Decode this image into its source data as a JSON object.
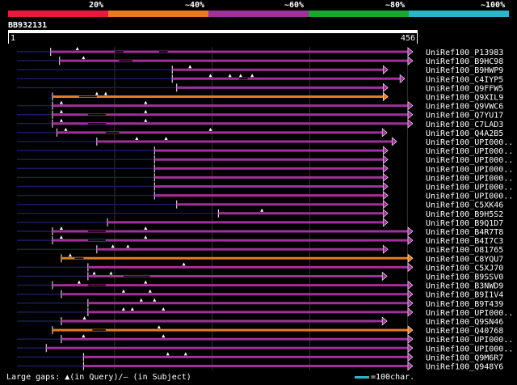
{
  "identity_legend": {
    "labels": [
      "20%",
      "~40%",
      "~60%",
      "~80%",
      "~100%"
    ],
    "colors": [
      "#e8193a",
      "#ea7a1f",
      "#a0309a",
      "#18a82e",
      "#2bb7c9"
    ]
  },
  "query": {
    "name": "BB932131",
    "start": "1",
    "end": "456",
    "length": 456
  },
  "gridlines": [
    120,
    230,
    340,
    450
  ],
  "hits": [
    {
      "label": "UniRef100_P13983",
      "color": "#a0309a",
      "start": 48,
      "end": 456,
      "dim": [
        [
          10,
          48
        ]
      ],
      "gaps": [
        [
          120,
          130
        ],
        [
          170,
          180
        ]
      ],
      "marks": [
        78
      ]
    },
    {
      "label": "UniRef100_B9HC98",
      "color": "#a0309a",
      "start": 58,
      "end": 456,
      "dim": [
        [
          10,
          58
        ]
      ],
      "gaps": [
        [
          125,
          140
        ]
      ],
      "marks": [
        85
      ]
    },
    {
      "label": "UniRef100_B9HWP9",
      "color": "#a0309a",
      "start": 185,
      "end": 428,
      "dim": [
        [
          10,
          185
        ]
      ],
      "gaps": [],
      "marks": [
        205
      ]
    },
    {
      "label": "UniRef100_C4IYP5",
      "color": "#a0309a",
      "start": 185,
      "end": 447,
      "dim": [
        [
          10,
          185
        ]
      ],
      "gaps": [
        [
          260,
          270
        ]
      ],
      "marks": [
        228,
        250,
        262,
        275
      ]
    },
    {
      "label": "UniRef100_Q9FFW5",
      "color": "#a0309a",
      "start": 190,
      "end": 428,
      "dim": [
        [
          10,
          190
        ]
      ],
      "gaps": [],
      "marks": []
    },
    {
      "label": "UniRef100_Q9XIL9",
      "color": "#ea7a1f",
      "start": 50,
      "end": 428,
      "dim": [],
      "gaps": [
        [
          80,
          100
        ]
      ],
      "marks": [
        100,
        110
      ]
    },
    {
      "label": "UniRef100_Q9VWC6",
      "color": "#a0309a",
      "start": 50,
      "end": 456,
      "dim": [
        [
          10,
          50
        ]
      ],
      "gaps": [],
      "marks": [
        60,
        155
      ]
    },
    {
      "label": "UniRef100_Q7YU17",
      "color": "#a0309a",
      "start": 50,
      "end": 456,
      "dim": [
        [
          10,
          50
        ]
      ],
      "gaps": [
        [
          90,
          110
        ]
      ],
      "marks": [
        60,
        155
      ]
    },
    {
      "label": "UniRef100_C7LAD3",
      "color": "#a0309a",
      "start": 50,
      "end": 456,
      "dim": [
        [
          10,
          50
        ]
      ],
      "gaps": [
        [
          90,
          110
        ]
      ],
      "marks": [
        60,
        155
      ]
    },
    {
      "label": "UniRef100_Q4A2B5",
      "color": "#a0309a",
      "start": 55,
      "end": 427,
      "dim": [
        [
          10,
          55
        ]
      ],
      "gaps": [
        [
          110,
          125
        ]
      ],
      "marks": [
        65,
        228
      ]
    },
    {
      "label": "UniRef100_UPI000..",
      "color": "#a0309a",
      "start": 100,
      "end": 438,
      "dim": [
        [
          10,
          100
        ]
      ],
      "gaps": [],
      "marks": [
        145,
        178
      ]
    },
    {
      "label": "UniRef100_UPI000..",
      "color": "#a0309a",
      "start": 165,
      "end": 428,
      "dim": [
        [
          10,
          165
        ]
      ],
      "gaps": [],
      "marks": []
    },
    {
      "label": "UniRef100_UPI000..",
      "color": "#a0309a",
      "start": 165,
      "end": 428,
      "dim": [
        [
          10,
          165
        ]
      ],
      "gaps": [],
      "marks": []
    },
    {
      "label": "UniRef100_UPI000..",
      "color": "#a0309a",
      "start": 165,
      "end": 428,
      "dim": [
        [
          10,
          165
        ]
      ],
      "gaps": [],
      "marks": []
    },
    {
      "label": "UniRef100_UPI000..",
      "color": "#a0309a",
      "start": 165,
      "end": 428,
      "dim": [
        [
          10,
          165
        ]
      ],
      "gaps": [],
      "marks": []
    },
    {
      "label": "UniRef100_UPI000..",
      "color": "#a0309a",
      "start": 165,
      "end": 428,
      "dim": [
        [
          10,
          165
        ]
      ],
      "gaps": [],
      "marks": []
    },
    {
      "label": "UniRef100_UPI000..",
      "color": "#a0309a",
      "start": 165,
      "end": 428,
      "dim": [
        [
          10,
          165
        ]
      ],
      "gaps": [],
      "marks": []
    },
    {
      "label": "UniRef100_C5XK46",
      "color": "#a0309a",
      "start": 190,
      "end": 428,
      "dim": [
        [
          10,
          190
        ]
      ],
      "gaps": [],
      "marks": []
    },
    {
      "label": "UniRef100_B9H5S2",
      "color": "#a0309a",
      "start": 237,
      "end": 428,
      "dim": [
        [
          10,
          237
        ]
      ],
      "gaps": [],
      "marks": [
        286
      ]
    },
    {
      "label": "UniRef100_B9Q1D7",
      "color": "#a0309a",
      "start": 112,
      "end": 428,
      "dim": [
        [
          10,
          112
        ]
      ],
      "gaps": [],
      "marks": []
    },
    {
      "label": "UniRef100_B4R7T8",
      "color": "#a0309a",
      "start": 50,
      "end": 456,
      "dim": [
        [
          10,
          50
        ]
      ],
      "gaps": [
        [
          90,
          110
        ]
      ],
      "marks": [
        60,
        155
      ]
    },
    {
      "label": "UniRef100_B4I7C3",
      "color": "#a0309a",
      "start": 50,
      "end": 456,
      "dim": [
        [
          10,
          50
        ]
      ],
      "gaps": [
        [
          90,
          110
        ]
      ],
      "marks": [
        60,
        155
      ]
    },
    {
      "label": "UniRef100_O81765",
      "color": "#a0309a",
      "start": 100,
      "end": 428,
      "dim": [
        [
          10,
          100
        ]
      ],
      "gaps": [],
      "marks": [
        118,
        135
      ]
    },
    {
      "label": "UniRef100_C8YQU7",
      "color": "#ea7a1f",
      "start": 60,
      "end": 456,
      "dim": [],
      "gaps": [
        [
          75,
          85
        ]
      ],
      "marks": [
        70
      ]
    },
    {
      "label": "UniRef100_C5XJ70",
      "color": "#a0309a",
      "start": 90,
      "end": 456,
      "dim": [
        [
          10,
          90
        ]
      ],
      "gaps": [],
      "marks": [
        198
      ]
    },
    {
      "label": "UniRef100_B9SSV0",
      "color": "#a0309a",
      "start": 90,
      "end": 427,
      "dim": [
        [
          10,
          90
        ]
      ],
      "gaps": [
        [
          130,
          160
        ]
      ],
      "marks": [
        97,
        116
      ]
    },
    {
      "label": "UniRef100_B3NWD9",
      "color": "#a0309a",
      "start": 50,
      "end": 456,
      "dim": [
        [
          10,
          50
        ]
      ],
      "gaps": [
        [
          90,
          110
        ]
      ],
      "marks": [
        80,
        155
      ]
    },
    {
      "label": "UniRef100_B9I1V4",
      "color": "#a0309a",
      "start": 60,
      "end": 456,
      "dim": [
        [
          10,
          60
        ]
      ],
      "gaps": [],
      "marks": [
        130,
        160
      ]
    },
    {
      "label": "UniRef100_B9T439",
      "color": "#a0309a",
      "start": 90,
      "end": 456,
      "dim": [
        [
          10,
          90
        ]
      ],
      "gaps": [],
      "marks": [
        150,
        165
      ]
    },
    {
      "label": "UniRef100_UPI000..",
      "color": "#a0309a",
      "start": 90,
      "end": 456,
      "dim": [
        [
          10,
          90
        ]
      ],
      "gaps": [],
      "marks": [
        130,
        140,
        175
      ]
    },
    {
      "label": "UniRef100_Q9SN46",
      "color": "#a0309a",
      "start": 60,
      "end": 427,
      "dim": [
        [
          10,
          60
        ]
      ],
      "gaps": [],
      "marks": [
        86
      ]
    },
    {
      "label": "UniRef100_Q40768",
      "color": "#ea7a1f",
      "start": 50,
      "end": 456,
      "dim": [],
      "gaps": [
        [
          95,
          110
        ]
      ],
      "marks": [
        170
      ]
    },
    {
      "label": "UniRef100_UPI000..",
      "color": "#a0309a",
      "start": 60,
      "end": 456,
      "dim": [
        [
          10,
          60
        ]
      ],
      "gaps": [],
      "marks": [
        85,
        175
      ]
    },
    {
      "label": "UniRef100_UPI000..",
      "color": "#a0309a",
      "start": 43,
      "end": 456,
      "dim": [
        [
          10,
          43
        ]
      ],
      "gaps": [],
      "marks": []
    },
    {
      "label": "UniRef100_Q9M6R7",
      "color": "#a0309a",
      "start": 85,
      "end": 456,
      "dim": [
        [
          10,
          85
        ]
      ],
      "gaps": [],
      "marks": [
        180,
        200
      ]
    },
    {
      "label": "UniRef100_Q948Y6",
      "color": "#a0309a",
      "start": 85,
      "end": 456,
      "dim": [
        [
          10,
          85
        ]
      ],
      "gaps": [],
      "marks": []
    }
  ],
  "footer": {
    "gaps_text": "Large gaps: ▲(in Query)/– (in Subject)",
    "scale_text": "=100char."
  }
}
